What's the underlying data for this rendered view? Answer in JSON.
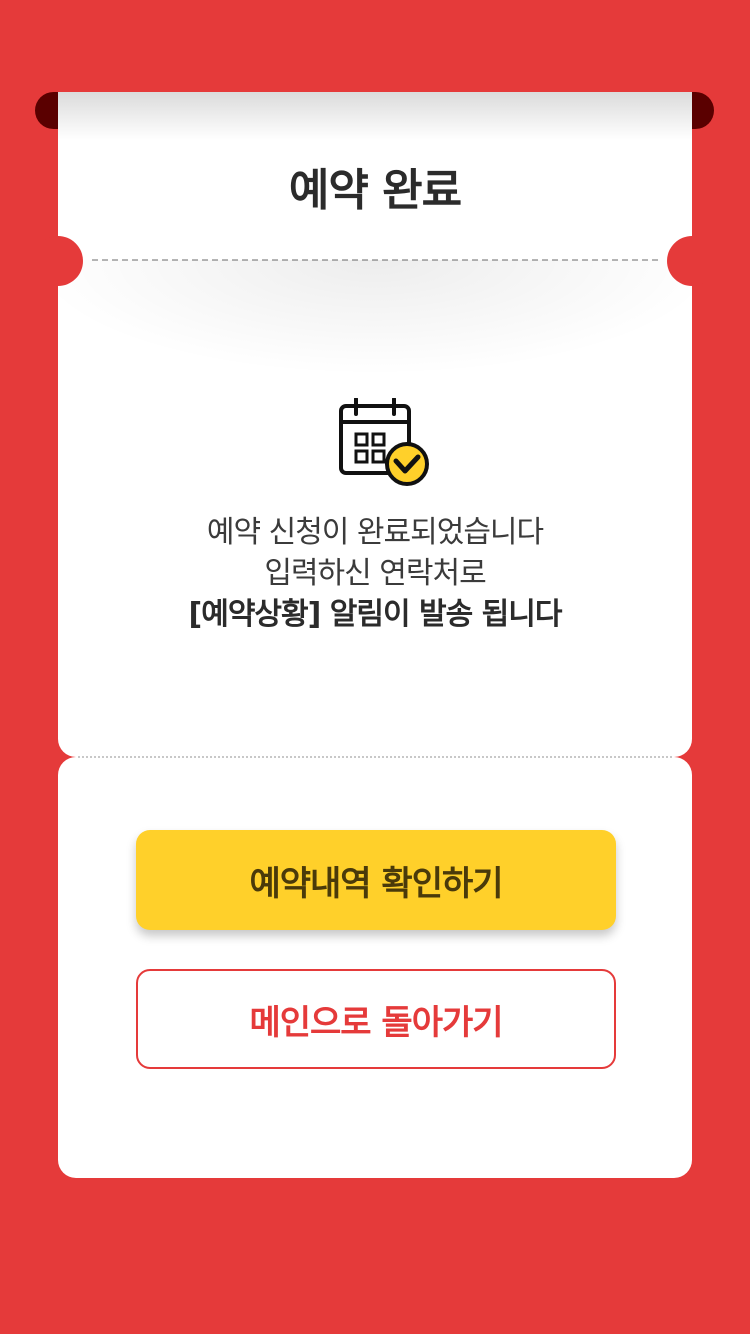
{
  "page": {
    "title": "예약 완료"
  },
  "icon": {
    "name": "calendar-check-icon"
  },
  "message": {
    "line1": "예약 신청이 완료되었습니다",
    "line2": "입력하신 연락처로",
    "line3": "[예약상황] 알림이 발송 됩니다"
  },
  "actions": {
    "check_reservation_label": "예약내역 확인하기",
    "back_to_main_label": "메인으로 돌아가기"
  },
  "colors": {
    "background": "#e53a3a",
    "primary_button": "#ffd02a",
    "accent": "#e53a3a"
  }
}
